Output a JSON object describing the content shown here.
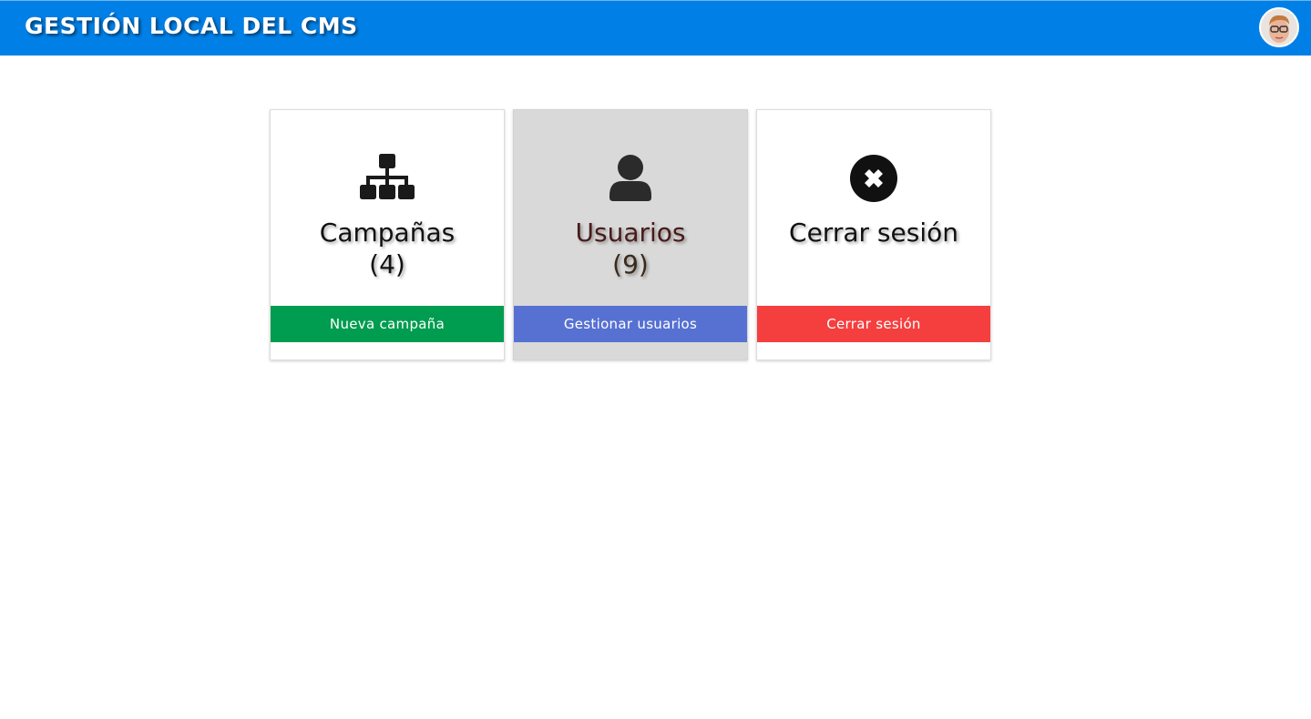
{
  "header": {
    "title": "GESTIÓN LOCAL DEL CMS",
    "avatar_icon": "user-avatar"
  },
  "cards": [
    {
      "icon": "sitemap-icon",
      "title": "Campañas",
      "count": "(4)",
      "button_label": "Nueva campaña",
      "button_color": "#009c4f",
      "active": false
    },
    {
      "icon": "user-icon",
      "title": "Usuarios",
      "count": "(9)",
      "button_label": "Gestionar usuarios",
      "button_color": "#5771d3",
      "active": true
    },
    {
      "icon": "close-circle-icon",
      "title": "Cerrar sesión",
      "count": "",
      "button_label": "Cerrar sesión",
      "button_color": "#f53f3f",
      "active": false
    }
  ],
  "colors": {
    "header_bg": "#0080e6",
    "active_card_bg": "#d9d9d9"
  }
}
